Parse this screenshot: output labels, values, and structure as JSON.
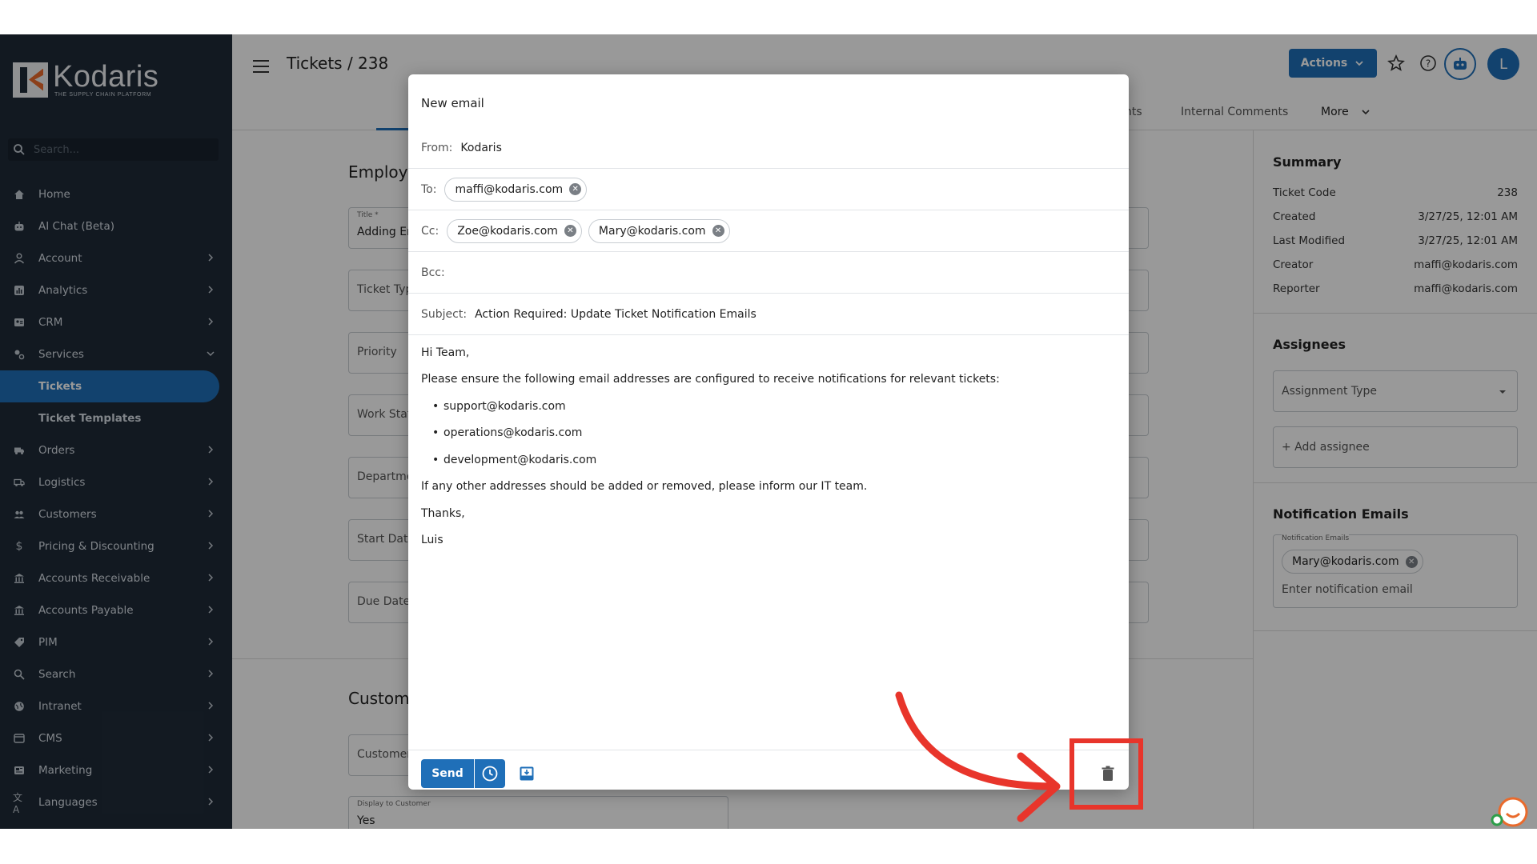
{
  "sidebar": {
    "logo_name": "Kodaris",
    "logo_tagline": "THE SUPPLY CHAIN PLATFORM",
    "search_placeholder": "Search...",
    "items": [
      {
        "label": "Home"
      },
      {
        "label": "AI Chat (Beta)"
      },
      {
        "label": "Account"
      },
      {
        "label": "Analytics"
      },
      {
        "label": "CRM"
      },
      {
        "label": "Services"
      },
      {
        "label": "Tickets"
      },
      {
        "label": "Ticket Templates"
      },
      {
        "label": "Orders"
      },
      {
        "label": "Logistics"
      },
      {
        "label": "Customers"
      },
      {
        "label": "Pricing & Discounting"
      },
      {
        "label": "Accounts Receivable"
      },
      {
        "label": "Accounts Payable"
      },
      {
        "label": "PIM"
      },
      {
        "label": "Search"
      },
      {
        "label": "Intranet"
      },
      {
        "label": "CMS"
      },
      {
        "label": "Marketing"
      },
      {
        "label": "Languages"
      }
    ]
  },
  "header": {
    "title": "Tickets / 238",
    "actions_label": "Actions",
    "avatar_initial": "L",
    "tabs": [
      "nts",
      "Internal Comments",
      "More"
    ]
  },
  "main": {
    "section_employee": "Employe",
    "title_small": "Title *",
    "title_value": "Adding Er",
    "ticket_type": "Ticket Typ",
    "priority": "Priority",
    "work_status": "Work Stat",
    "department": "Departme",
    "start_date": "Start Date",
    "due_date": "Due Date",
    "section_customer": "Custome",
    "customer": "Customer",
    "display_small": "Display to Customer",
    "display_value": "Yes"
  },
  "summary": {
    "title": "Summary",
    "rows": [
      {
        "k": "Ticket Code",
        "v": "238"
      },
      {
        "k": "Created",
        "v": "3/27/25, 12:01 AM"
      },
      {
        "k": "Last Modified",
        "v": "3/27/25, 12:01 AM"
      },
      {
        "k": "Creator",
        "v": "maffi@kodaris.com"
      },
      {
        "k": "Reporter",
        "v": "maffi@kodaris.com"
      }
    ]
  },
  "assignees": {
    "title": "Assignees",
    "type_label": "Assignment Type",
    "add_label": "+ Add assignee"
  },
  "notification": {
    "title": "Notification Emails",
    "small_label": "Notification Emails",
    "chip": "Mary@kodaris.com",
    "placeholder": "Enter notification email"
  },
  "email": {
    "title": "New email",
    "from_label": "From:",
    "from_value": "Kodaris",
    "to_label": "To:",
    "to": [
      "maffi@kodaris.com"
    ],
    "cc_label": "Cc:",
    "cc": [
      "Zoe@kodaris.com",
      "Mary@kodaris.com"
    ],
    "bcc_label": "Bcc:",
    "subject_label": "Subject:",
    "subject_value": "Action Required: Update Ticket Notification Emails",
    "greeting": "Hi Team,",
    "line1": "Please ensure the following email addresses are configured to receive notifications for relevant tickets:",
    "bullets": [
      "support@kodaris.com",
      "operations@kodaris.com",
      "development@kodaris.com"
    ],
    "line2": "If any other addresses should be added or removed, please inform our IT team.",
    "closing": "Thanks,",
    "signature": "Luis",
    "send_label": "Send"
  },
  "colors": {
    "primary": "#1f6fb8",
    "sidebar": "#1f2b38",
    "annotation": "#e8352b"
  }
}
